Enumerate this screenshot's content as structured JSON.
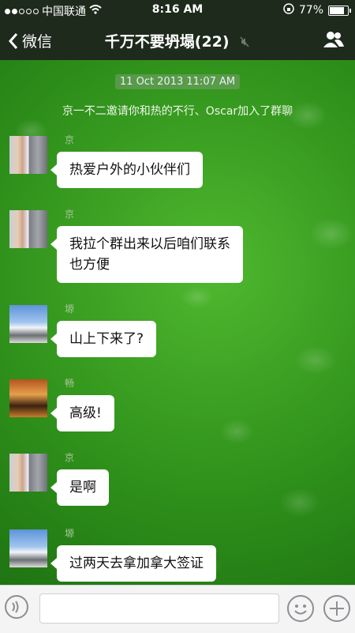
{
  "status": {
    "carrier": "中国联通",
    "time": "8:16 AM",
    "battery": "77%",
    "battery_level": 0.77
  },
  "nav": {
    "back_label": "微信",
    "title": "千万不要坍塌(22)"
  },
  "chat": {
    "timestamp": "11 Oct 2013 11:07 AM",
    "system_message": "京一不二邀请你和热的不行、Oscar加入了群聊",
    "messages": [
      {
        "name": "京",
        "line1": "热爱户外的小伙伴们",
        "line2": "",
        "avatar": "faces"
      },
      {
        "name": "京",
        "line1": "我拉个群出来以后咱们联系",
        "line2": "也方便",
        "avatar": "faces"
      },
      {
        "name": "塬",
        "line1": "山上下来了?",
        "line2": "",
        "avatar": "mountain"
      },
      {
        "name": "畅",
        "line1": "高级!",
        "line2": "",
        "avatar": "warm"
      },
      {
        "name": "京",
        "line1": "是啊",
        "line2": "",
        "avatar": "faces"
      },
      {
        "name": "塬",
        "line1": "过两天去拿加拿大签证",
        "line2": "",
        "avatar": "mountain"
      }
    ]
  },
  "input": {
    "placeholder": ""
  }
}
